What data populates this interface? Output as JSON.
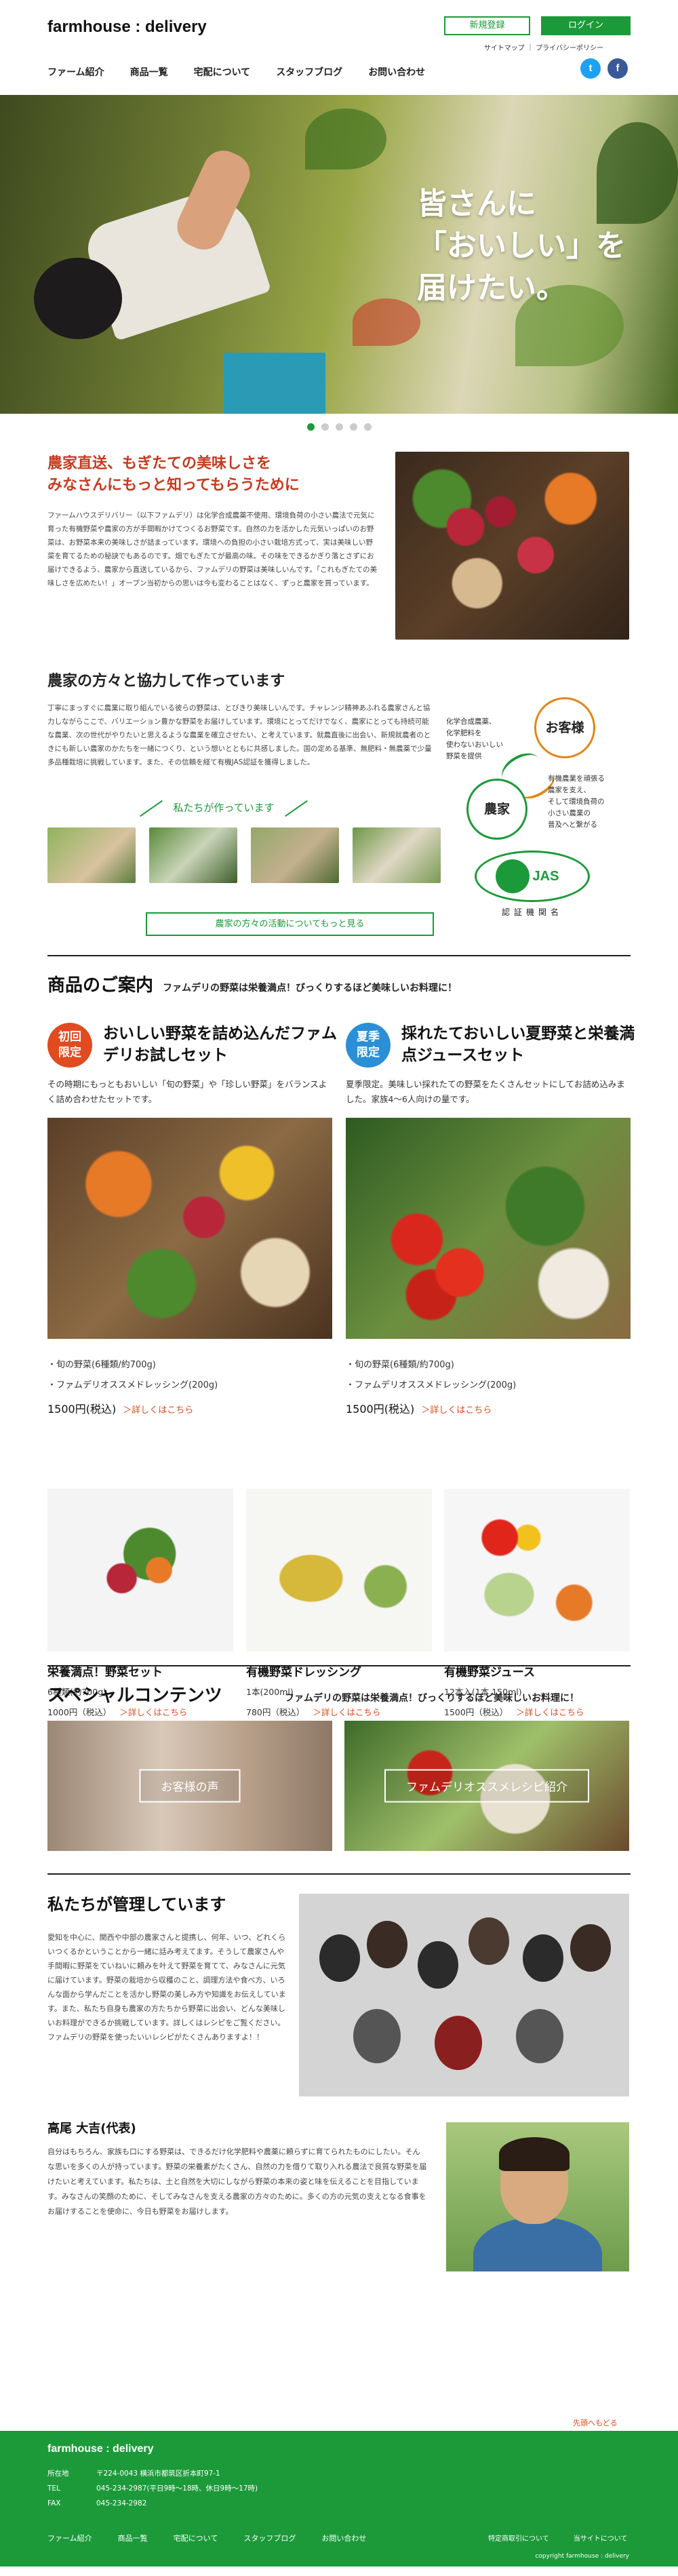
{
  "header": {
    "logo": "farmhouse : delivery",
    "register_label": "新規登録",
    "login_label": "ログイン",
    "sitemap_label": "サイトマップ",
    "privacy_label": "プライバシーポリシー",
    "twitter_glyph": "t",
    "facebook_glyph": "f",
    "nav": [
      "ファーム紹介",
      "商品一覧",
      "宅配について",
      "スタッフブログ",
      "お問い合わせ"
    ]
  },
  "hero": {
    "line1": "皆さんに",
    "line2": "「おいしい」を",
    "line3": "届けたい。",
    "slide_count": 5,
    "active_slide": 1
  },
  "intro": {
    "title_line1": "農家直送、もぎたての美味しさを",
    "title_line2": "みなさんにもっと知ってもらうために",
    "body": "ファームハウスデリバリー（以下ファムデリ）は化学合成農薬不使用、環境負荷の小さい農法で元気に育った有機野菜や農家の方が手間暇かけてつくるお野菜です。自然の力を活かした元気いっぱいのお野菜は、お野菜本来の美味しさが詰まっています。環境への負担の小さい栽培方式って、実は美味しい野菜を育てるための秘訣でもあるのです。畑でもぎたてが最高の味。その味をできるかぎり落とさずにお届けできるよう、農家から直送しているから、ファムデリの野菜は美味しいんです。「これもぎたての美味しさを広めたい！」オープン当初からの思いは今も変わることはなく、ずっと農家を買っています。"
  },
  "partner": {
    "title": "農家の方々と協力して作っています",
    "body": "丁寧にまっすぐに農業に取り組んでいる彼らの野菜は、とびきり美味しいんです。チャレンジ精神あふれる農家さんと協力しながらここで、バリエーション豊かな野菜をお届けしています。環境にとってだけでなく、農家にとっても持続可能な農業、次の世代がやりたいと思えるような農業を確立させたい、と考えています。就農直後に出会い、新規就農者のときにも新しい農家のかたちを一緒につくり、という想いとともに共感しました。国の定める基準、無肥料・無農薬で少量多品種栽培に挑戦しています。また、その信頼を経て有機JAS認証を獲得しました。",
    "cycle_customer": "お客様",
    "cycle_farmer": "農家",
    "cycle_text1": "化学合成農薬、\n化学肥料を\n使わないおいしい\n野菜を提供",
    "cycle_text2": "有機農業を頑張る\n農家を支え、\nそして環境負荷の\n小さい農業の\n普及へと繋がる",
    "jas_logo": "JAS",
    "jas_label": "認証機関名",
    "farmers_heading": "私たちが作っています",
    "more_label": "農家の方々の活動についてもっと見る"
  },
  "products": {
    "title": "商品のご案内",
    "subtitle": "ファムデリの野菜は栄養満点！びっくりするほど美味しいお料理に！",
    "set1": {
      "badge_line1": "初回",
      "badge_line2": "限定",
      "title": "おいしい野菜を詰め込んだファムデリお試しセット",
      "desc": "その時期にもっともおいしい「旬の野菜」や「珍しい野菜」をバランスよく詰め合わせたセットです。",
      "item1": "・旬の野菜(6種類/約700g)",
      "item2": "・ファムデリオススメドレッシング(200g)",
      "price": "1500円(税込)",
      "more": "＞詳しくはこちら"
    },
    "set2": {
      "badge_line1": "夏季",
      "badge_line2": "限定",
      "title": "採れたておいしい夏野菜と栄養満点ジュースセット",
      "desc": "夏季限定。美味しい採れたての野菜をたくさんセットにしてお詰め込みました。家族4〜6人向けの量です。",
      "item1": "・旬の野菜(6種類/約700g)",
      "item2": "・ファムデリオススメドレッシング(200g)",
      "price": "1500円(税込)",
      "more": "＞詳しくはこちら"
    },
    "small": [
      {
        "name": "栄養満点！野菜セット",
        "spec": "6種類(約700g)",
        "price": "1000円（税込）",
        "more": "＞詳しくはこちら"
      },
      {
        "name": "有機野菜ドレッシング",
        "spec": "1本(200ml)",
        "price": "780円（税込）",
        "more": "＞詳しくはこちら"
      },
      {
        "name": "有機野菜ジュース",
        "spec": "12本入(1本 150ml)",
        "price": "1500円（税込）",
        "more": "＞詳しくはこちら"
      }
    ]
  },
  "special": {
    "title": "スペシャルコンテンツ",
    "subtitle": "ファムデリの野菜は栄養満点！びっくりするほど美味しいお料理に！",
    "banner1": "お客様の声",
    "banner2": "ファムデリオススメレシピ紹介"
  },
  "manage": {
    "title": "私たちが管理しています",
    "body": "愛知を中心に、関西や中部の農家さんと提携し、何年、いつ、どれくらいつくるかということから一緒に話み考えてます。そうして農家さんや手間暇に野菜をていねいに頼みを叶えて野菜を育てて、みなさんに元気に届けています。野菜の栽培から収穫のこと、調理方法や食べ方、いろんな面から学んだことを活かし野菜の美しみ方や知識をお伝えしています。また、私たち自身も農家の方たちから野菜に出会い、どんな美味しいお料理ができるか挑戦しています。詳しくはレシピをご覧ください。ファムデリの野菜を使ったいいレシピがたくさんありますよ！！",
    "ceo_title": "高尾 大吉(代表)",
    "ceo_body": "自分はもちろん、家族も口にする野菜は、できるだけ化学肥料や農薬に頼らずに育てられたものにしたい。そんな思いを多くの人が持っています。野菜の栄養素がたくさん、自然の力を借りて取り入れる農法で良質な野菜を届けたいと考えています。私たちは、土と自然を大切にしながら野菜の本来の姿と味を伝えることを目指しています。みなさんの笑顔のために、そしてみなさんを支える農家の方々のために。多くの方の元気の支えとなる食事をお届けすることを使命に、今日も野菜をお届けします。",
    "to_top": "先頭へもどる"
  },
  "footer": {
    "logo": "farmhouse : delivery",
    "address_label": "所在地",
    "address": "〒224-0043 横浜市都筑区折本町97-1",
    "tel_label": "TEL",
    "tel": "045-234-2987(平日9時〜18時、休日9時〜17時)",
    "fax_label": "FAX",
    "fax": "045-234-2982",
    "nav": [
      "ファーム紹介",
      "商品一覧",
      "宅配について",
      "スタッフブログ",
      "お問い合わせ"
    ],
    "sub1": "特定商取引について",
    "sub2": "当サイトについて",
    "copyright": "copyright farmhouse : delivery"
  },
  "colors": {
    "brand_green": "#1c9a3a",
    "accent_red": "#c63a1f",
    "link_orange": "#e24a1f",
    "customer_orange": "#e3861a"
  },
  "icons": {
    "twitter": "twitter-icon",
    "facebook": "facebook-icon"
  }
}
